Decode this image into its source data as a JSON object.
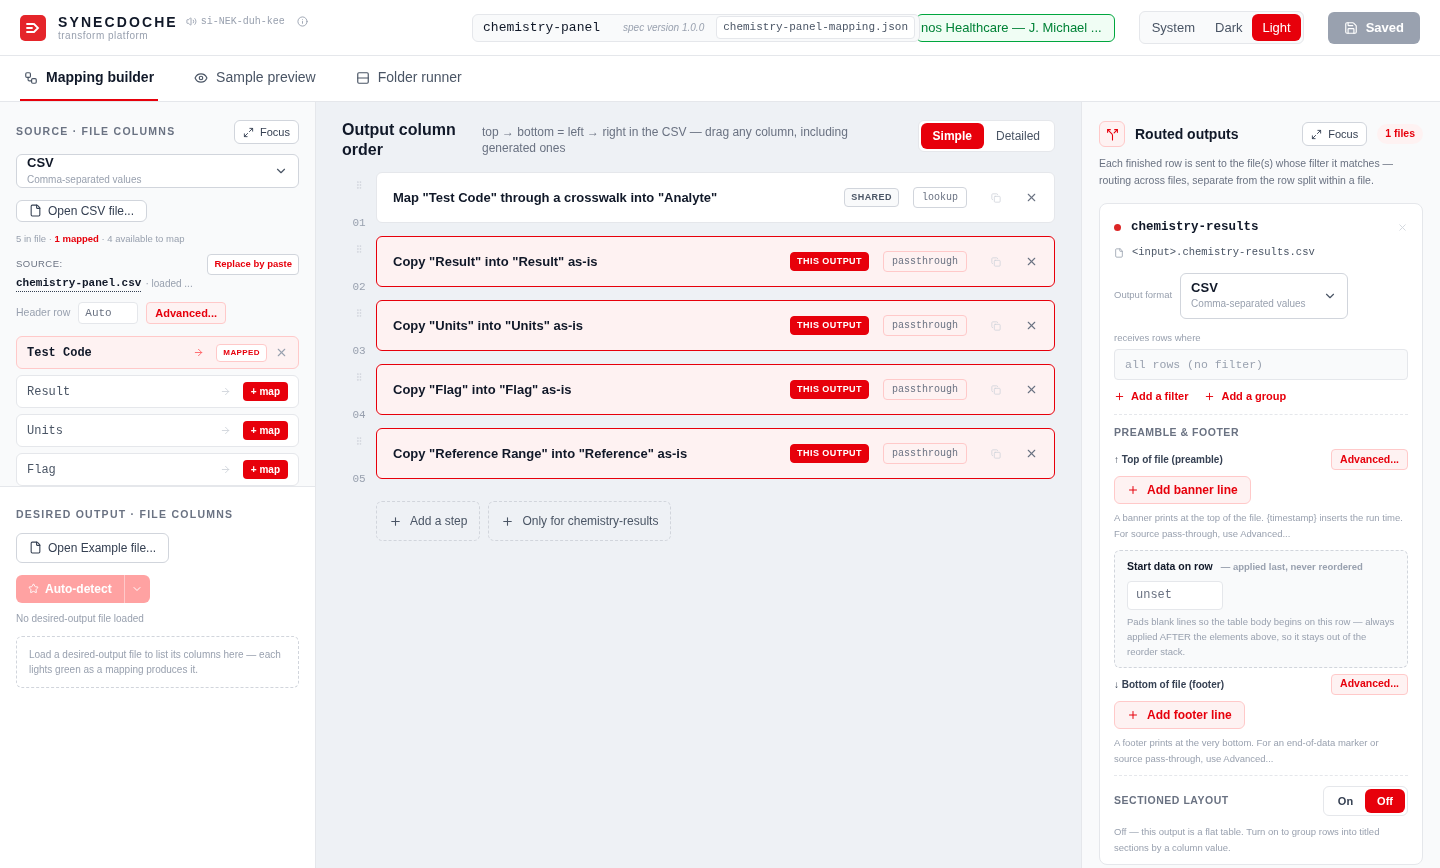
{
  "header": {
    "brand": {
      "name": "SYNECDOCHE",
      "subtitle": "transform platform",
      "pronunciation": "si-NEK-duh-kee"
    },
    "project": {
      "name": "chemistry-panel",
      "spec": "spec version 1.0.0",
      "file": "chemistry-panel-mapping.json",
      "org": "nos Healthcare — J. Michael ..."
    },
    "theme": [
      {
        "label": "System",
        "selected": false
      },
      {
        "label": "Dark",
        "selected": false
      },
      {
        "label": "Light",
        "selected": true
      }
    ],
    "save": {
      "label": "Saved",
      "disabled": true
    }
  },
  "tabs": [
    {
      "label": "Mapping builder",
      "selected": true,
      "kind": "builder"
    },
    {
      "label": "Sample preview",
      "selected": false,
      "kind": "preview"
    },
    {
      "label": "Folder runner",
      "selected": false,
      "kind": "runner"
    }
  ],
  "source": {
    "title": "SOURCE · FILE COLUMNS",
    "focus": "Focus",
    "format": {
      "name": "CSV",
      "description": "Comma-separated values"
    },
    "open_button": "Open CSV file...",
    "stats": {
      "before": "5 in file · ",
      "highlight": "1 mapped",
      "after": " · 4 available to map"
    },
    "source_label": "SOURCE:",
    "replace_button": "Replace by paste",
    "file": {
      "name": "chemistry-panel.csv",
      "status": "· loaded ..."
    },
    "header_row": {
      "label": "Header row",
      "value": "Auto"
    },
    "advanced": "Advanced...",
    "columns": [
      {
        "name": "Test Code",
        "kind": "mapped",
        "badge": "MAPPED"
      },
      {
        "name": "Result",
        "kind": "unmapped",
        "action": "+ map"
      },
      {
        "name": "Units",
        "kind": "unmapped",
        "action": "+ map"
      },
      {
        "name": "Flag",
        "kind": "unmapped",
        "action": "+ map"
      }
    ]
  },
  "desired": {
    "title": "DESIRED OUTPUT · FILE COLUMNS",
    "open_button": "Open Example file...",
    "autodetect": {
      "label": "Auto-detect",
      "disabled": true
    },
    "status": "No desired-output file loaded",
    "empty_hint": "Load a desired-output file to list its columns here — each lights green as a mapping produces it."
  },
  "steps": {
    "title": "Output column order",
    "hint": "top → bottom = left → right in the CSV — drag any column, including generated ones",
    "modes": [
      {
        "label": "Simple",
        "selected": true
      },
      {
        "label": "Detailed",
        "selected": false
      }
    ],
    "items": [
      {
        "number": "01",
        "text": "Map \"Test Code\" through a crosswalk into \"Analyte\"",
        "scope": {
          "label": "SHARED",
          "kind": "shared"
        },
        "type": "lookup"
      },
      {
        "number": "02",
        "text": "Copy \"Result\" into \"Result\" as-is",
        "scope": {
          "label": "THIS OUTPUT",
          "kind": "this"
        },
        "type": "passthrough"
      },
      {
        "number": "03",
        "text": "Copy \"Units\" into \"Units\" as-is",
        "scope": {
          "label": "THIS OUTPUT",
          "kind": "this"
        },
        "type": "passthrough"
      },
      {
        "number": "04",
        "text": "Copy \"Flag\" into \"Flag\" as-is",
        "scope": {
          "label": "THIS OUTPUT",
          "kind": "this"
        },
        "type": "passthrough"
      },
      {
        "number": "05",
        "text": "Copy \"Reference Range\" into \"Reference\" as-is",
        "scope": {
          "label": "THIS OUTPUT",
          "kind": "this"
        },
        "type": "passthrough"
      }
    ],
    "add_buttons": [
      "Add a step",
      "Only for chemistry-results"
    ]
  },
  "routed": {
    "title": "Routed outputs",
    "focus": "Focus",
    "count": "1 files",
    "description": "Each finished row is sent to the file(s) whose filter it matches — routing across files, separate from the row split within a file.",
    "output": {
      "name": "chemistry-results",
      "color": "#dc2626",
      "path": "<input>.chemistry-results.csv",
      "format_label": "Output format",
      "format": {
        "name": "CSV",
        "description": "Comma-separated values"
      },
      "filter_label": "receives rows where",
      "filter_placeholder": "all rows (no filter)",
      "filter_actions": [
        "Add a filter",
        "Add a group"
      ],
      "preamble_title": "PREAMBLE & FOOTER",
      "top": {
        "label": "↑ Top of file (preamble)",
        "advanced": "Advanced...",
        "add": "Add banner line",
        "help": "A banner prints at the top of the file. {timestamp} inserts the run time. For source pass-through, use Advanced..."
      },
      "start": {
        "label": "Start data on row",
        "note": "— applied last, never reordered",
        "placeholder": "unset",
        "help": "Pads blank lines so the table body begins on this row — always applied AFTER the elements above, so it stays out of the reorder stack."
      },
      "bottom": {
        "label": "↓ Bottom of file (footer)",
        "advanced": "Advanced...",
        "add": "Add footer line",
        "help": "A footer prints at the very bottom. For an end-of-data marker or source pass-through, use Advanced..."
      },
      "sectioned": {
        "title": "SECTIONED LAYOUT",
        "options": [
          {
            "label": "On",
            "selected": false
          },
          {
            "label": "Off",
            "selected": true
          }
        ],
        "help": "Off — this output is a flat table. Turn on to group rows into titled sections by a column value."
      }
    }
  }
}
